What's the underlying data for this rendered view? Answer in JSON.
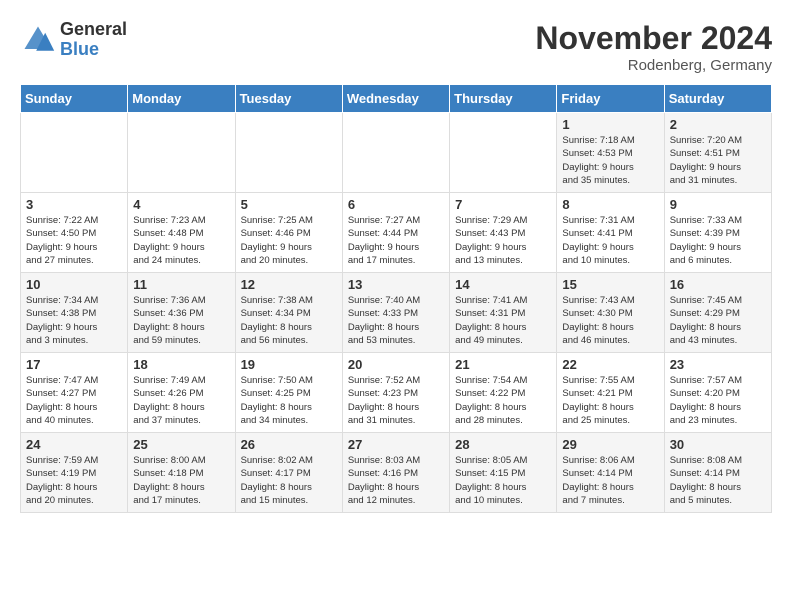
{
  "logo": {
    "general": "General",
    "blue": "Blue"
  },
  "title": "November 2024",
  "location": "Rodenberg, Germany",
  "days_header": [
    "Sunday",
    "Monday",
    "Tuesday",
    "Wednesday",
    "Thursday",
    "Friday",
    "Saturday"
  ],
  "weeks": [
    [
      {
        "day": "",
        "info": ""
      },
      {
        "day": "",
        "info": ""
      },
      {
        "day": "",
        "info": ""
      },
      {
        "day": "",
        "info": ""
      },
      {
        "day": "",
        "info": ""
      },
      {
        "day": "1",
        "info": "Sunrise: 7:18 AM\nSunset: 4:53 PM\nDaylight: 9 hours\nand 35 minutes."
      },
      {
        "day": "2",
        "info": "Sunrise: 7:20 AM\nSunset: 4:51 PM\nDaylight: 9 hours\nand 31 minutes."
      }
    ],
    [
      {
        "day": "3",
        "info": "Sunrise: 7:22 AM\nSunset: 4:50 PM\nDaylight: 9 hours\nand 27 minutes."
      },
      {
        "day": "4",
        "info": "Sunrise: 7:23 AM\nSunset: 4:48 PM\nDaylight: 9 hours\nand 24 minutes."
      },
      {
        "day": "5",
        "info": "Sunrise: 7:25 AM\nSunset: 4:46 PM\nDaylight: 9 hours\nand 20 minutes."
      },
      {
        "day": "6",
        "info": "Sunrise: 7:27 AM\nSunset: 4:44 PM\nDaylight: 9 hours\nand 17 minutes."
      },
      {
        "day": "7",
        "info": "Sunrise: 7:29 AM\nSunset: 4:43 PM\nDaylight: 9 hours\nand 13 minutes."
      },
      {
        "day": "8",
        "info": "Sunrise: 7:31 AM\nSunset: 4:41 PM\nDaylight: 9 hours\nand 10 minutes."
      },
      {
        "day": "9",
        "info": "Sunrise: 7:33 AM\nSunset: 4:39 PM\nDaylight: 9 hours\nand 6 minutes."
      }
    ],
    [
      {
        "day": "10",
        "info": "Sunrise: 7:34 AM\nSunset: 4:38 PM\nDaylight: 9 hours\nand 3 minutes."
      },
      {
        "day": "11",
        "info": "Sunrise: 7:36 AM\nSunset: 4:36 PM\nDaylight: 8 hours\nand 59 minutes."
      },
      {
        "day": "12",
        "info": "Sunrise: 7:38 AM\nSunset: 4:34 PM\nDaylight: 8 hours\nand 56 minutes."
      },
      {
        "day": "13",
        "info": "Sunrise: 7:40 AM\nSunset: 4:33 PM\nDaylight: 8 hours\nand 53 minutes."
      },
      {
        "day": "14",
        "info": "Sunrise: 7:41 AM\nSunset: 4:31 PM\nDaylight: 8 hours\nand 49 minutes."
      },
      {
        "day": "15",
        "info": "Sunrise: 7:43 AM\nSunset: 4:30 PM\nDaylight: 8 hours\nand 46 minutes."
      },
      {
        "day": "16",
        "info": "Sunrise: 7:45 AM\nSunset: 4:29 PM\nDaylight: 8 hours\nand 43 minutes."
      }
    ],
    [
      {
        "day": "17",
        "info": "Sunrise: 7:47 AM\nSunset: 4:27 PM\nDaylight: 8 hours\nand 40 minutes."
      },
      {
        "day": "18",
        "info": "Sunrise: 7:49 AM\nSunset: 4:26 PM\nDaylight: 8 hours\nand 37 minutes."
      },
      {
        "day": "19",
        "info": "Sunrise: 7:50 AM\nSunset: 4:25 PM\nDaylight: 8 hours\nand 34 minutes."
      },
      {
        "day": "20",
        "info": "Sunrise: 7:52 AM\nSunset: 4:23 PM\nDaylight: 8 hours\nand 31 minutes."
      },
      {
        "day": "21",
        "info": "Sunrise: 7:54 AM\nSunset: 4:22 PM\nDaylight: 8 hours\nand 28 minutes."
      },
      {
        "day": "22",
        "info": "Sunrise: 7:55 AM\nSunset: 4:21 PM\nDaylight: 8 hours\nand 25 minutes."
      },
      {
        "day": "23",
        "info": "Sunrise: 7:57 AM\nSunset: 4:20 PM\nDaylight: 8 hours\nand 23 minutes."
      }
    ],
    [
      {
        "day": "24",
        "info": "Sunrise: 7:59 AM\nSunset: 4:19 PM\nDaylight: 8 hours\nand 20 minutes."
      },
      {
        "day": "25",
        "info": "Sunrise: 8:00 AM\nSunset: 4:18 PM\nDaylight: 8 hours\nand 17 minutes."
      },
      {
        "day": "26",
        "info": "Sunrise: 8:02 AM\nSunset: 4:17 PM\nDaylight: 8 hours\nand 15 minutes."
      },
      {
        "day": "27",
        "info": "Sunrise: 8:03 AM\nSunset: 4:16 PM\nDaylight: 8 hours\nand 12 minutes."
      },
      {
        "day": "28",
        "info": "Sunrise: 8:05 AM\nSunset: 4:15 PM\nDaylight: 8 hours\nand 10 minutes."
      },
      {
        "day": "29",
        "info": "Sunrise: 8:06 AM\nSunset: 4:14 PM\nDaylight: 8 hours\nand 7 minutes."
      },
      {
        "day": "30",
        "info": "Sunrise: 8:08 AM\nSunset: 4:14 PM\nDaylight: 8 hours\nand 5 minutes."
      }
    ]
  ]
}
